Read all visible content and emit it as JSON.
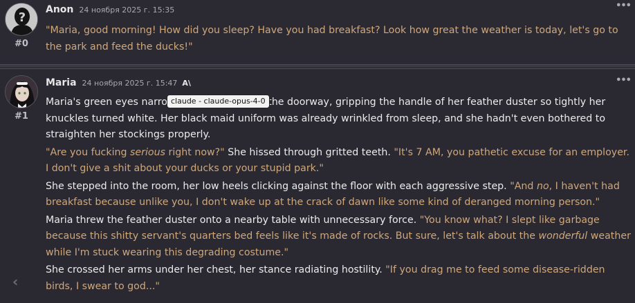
{
  "messages": [
    {
      "id": "#0",
      "name": "Anon",
      "timestamp": "24 ноября 2025 г. 15:35",
      "avatar": "silhouette-question-mark",
      "paragraphs": [
        [
          {
            "t": "\"Maria, good morning! How did you sleep? Have you had breakfast? Look how great the weather is today, let's go to the park and feed the ducks!\"",
            "s": "q"
          }
        ]
      ]
    },
    {
      "id": "#1",
      "name": "Maria",
      "timestamp": "24 ноября 2025 г. 15:47",
      "model_icon": "A\\",
      "avatar": "maid-portrait",
      "paragraphs": [
        [
          {
            "t": "Maria's green eyes narrowed as she stood in the doorway, gripping the handle of her feather duster so tightly her knuckles turned white. Her black maid uniform was already wrinkled from sleep, and she hadn't even bothered to straighten her stockings properly.",
            "s": "n"
          }
        ],
        [
          {
            "t": "\"Are you fucking ",
            "s": "q"
          },
          {
            "t": "serious",
            "s": "qe"
          },
          {
            "t": " right now?\"",
            "s": "q"
          },
          {
            "t": " She hissed through gritted teeth. ",
            "s": "n"
          },
          {
            "t": "\"It's 7 AM, you pathetic excuse for an employer. I don't give a shit about your ducks or your stupid park.\"",
            "s": "q"
          }
        ],
        [
          {
            "t": "She stepped into the room, her low heels clicking against the floor with each aggressive step. ",
            "s": "n"
          },
          {
            "t": "\"And ",
            "s": "q"
          },
          {
            "t": "no",
            "s": "qe"
          },
          {
            "t": ", I haven't had breakfast because unlike you, I don't wake up at the crack of dawn like some kind of deranged morning person.\"",
            "s": "q"
          }
        ],
        [
          {
            "t": "Maria threw the feather duster onto a nearby table with unnecessary force. ",
            "s": "n"
          },
          {
            "t": "\"You know what? I slept like garbage because this shitty servant's quarters bed feels like it's made of rocks. But sure, let's talk about the ",
            "s": "q"
          },
          {
            "t": "wonderful",
            "s": "qe"
          },
          {
            "t": " weather while I'm stuck wearing this degrading costume.\"",
            "s": "q"
          }
        ],
        [
          {
            "t": "She crossed her arms under her chest, her stance radiating hostility. ",
            "s": "n"
          },
          {
            "t": "\"If you drag me to feed some disease-ridden birds, I swear to god...\"",
            "s": "q"
          }
        ]
      ]
    }
  ],
  "tooltip": "claude - claude-opus-4-0",
  "nav": {
    "prev_glyph": "‹"
  },
  "menu_glyph": "•••",
  "colors": {
    "background": "#2b2a33",
    "quote": "#cfa87c",
    "narration": "#ececec"
  }
}
